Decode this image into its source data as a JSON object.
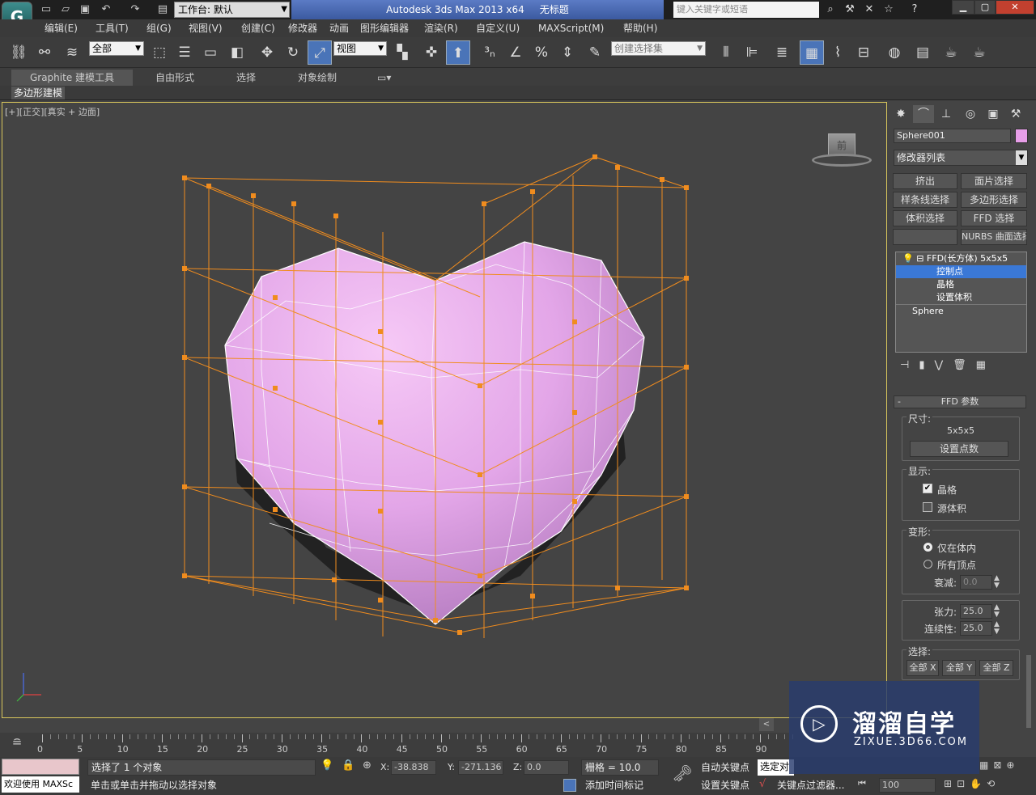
{
  "app": {
    "title": "Autodesk 3ds Max  2013 x64",
    "doc_title": "无标题",
    "workspace_label": "工作台: 默认",
    "search_placeholder": "键入关键字或短语"
  },
  "menu": [
    "编辑(E)",
    "工具(T)",
    "组(G)",
    "视图(V)",
    "创建(C)",
    "修改器",
    "动画",
    "图形编辑器",
    "渲染(R)",
    "自定义(U)",
    "MAXScript(M)",
    "帮助(H)"
  ],
  "toolbar": {
    "filter_value": "全部",
    "refcoord_value": "视图",
    "named_selection_placeholder": "创建选择集"
  },
  "ribbon": {
    "tabs": [
      "Graphite 建模工具",
      "自由形式",
      "选择",
      "对象绘制"
    ],
    "panel_label": "多边形建模"
  },
  "viewport": {
    "label": "[+][正交][真实 + 边面]",
    "viewcube_label": "前",
    "colors": {
      "heart": "#e3a6e8",
      "lattice": "#f08c1e",
      "background": "#444444"
    }
  },
  "command_panel": {
    "object_name": "Sphere001",
    "object_color": "#e79ee8",
    "modifier_list": "修改器列表",
    "modifier_buttons": [
      "挤出",
      "面片选择",
      "样条线选择",
      "多边形选择",
      "体积选择",
      "FFD 选择",
      "",
      "NURBS 曲面选择"
    ],
    "stack": [
      {
        "label": "FFD(长方体) 5x5x5",
        "level": 0
      },
      {
        "label": "控制点",
        "level": 1,
        "selected": true
      },
      {
        "label": "晶格",
        "level": 1
      },
      {
        "label": "设置体积",
        "level": 1
      },
      {
        "label": "Sphere",
        "level": 0
      }
    ],
    "rollout_title": "FFD 参数",
    "dimensions_label": "尺寸:",
    "dimensions_value": "5x5x5",
    "set_points_button": "设置点数",
    "display_label": "显示:",
    "lattice_label": "晶格",
    "lattice_checked": true,
    "source_volume_label": "源体积",
    "source_volume_checked": false,
    "deform_label": "变形:",
    "inside_volume_label": "仅在体内",
    "all_vertices_label": "所有顶点",
    "falloff_label": "衰减:",
    "falloff_value": "0.0",
    "tension_label": "张力:",
    "tension_value": "25.0",
    "continuity_label": "连续性:",
    "continuity_value": "25.0",
    "selection_label": "选择:",
    "select_buttons": [
      "全部 X",
      "全部 Y",
      "全部 Z"
    ]
  },
  "timeline": {
    "ticks": [
      "0",
      "5",
      "10",
      "15",
      "20",
      "25",
      "30",
      "35",
      "40",
      "45",
      "50",
      "55",
      "60",
      "65",
      "70",
      "75",
      "80",
      "85",
      "90"
    ]
  },
  "status": {
    "maxscript_label": "欢迎使用  MAXSc",
    "selection_text": "选择了 1 个对象",
    "prompt_text": "单击或单击并拖动以选择对象",
    "x_label": "X:",
    "x_value": "-38.838",
    "y_label": "Y:",
    "y_value": "-271.136",
    "z_label": "Z:",
    "z_value": "0.0",
    "grid_text": "栅格 = 10.0",
    "add_time_tag": "添加时间标记",
    "auto_key": "自动关键点",
    "set_key": "设置关键点",
    "selected_value": "选定对",
    "key_filter": "关键点过滤器...",
    "frame_value": "100"
  },
  "watermark": {
    "title": "溜溜自学",
    "url": "ZIXUE.3D66.COM"
  }
}
